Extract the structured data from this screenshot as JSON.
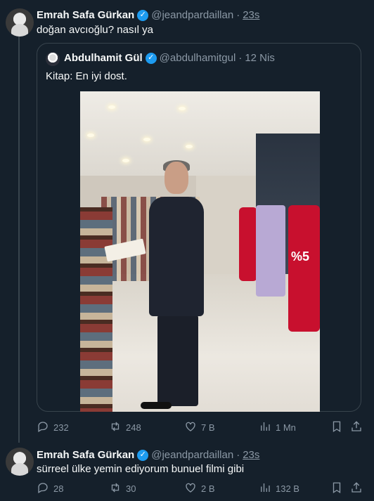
{
  "tweet1": {
    "author_name": "Emrah Safa Gürkan",
    "handle": "@jeandpardaillan",
    "separator": "·",
    "time": "23s",
    "text": "doğan avcıoğlu? nasıl ya",
    "quote": {
      "author_name": "Abdulhamit Gül",
      "handle": "@abdulhamitgul",
      "separator": "·",
      "date": "12 Nis",
      "text": "Kitap: En iyi dost."
    },
    "actions": {
      "replies": "232",
      "retweets": "248",
      "likes": "7 B",
      "views": "1 Mn"
    }
  },
  "tweet2": {
    "author_name": "Emrah Safa Gürkan",
    "handle": "@jeandpardaillan",
    "separator": "·",
    "time": "23s",
    "text": "sürreel ülke yemin ediyorum bunuel filmi gibi",
    "actions": {
      "replies": "28",
      "retweets": "30",
      "likes": "2 B",
      "views": "132 B"
    }
  },
  "colors": {
    "background": "#15202b",
    "text": "#f7f9f9",
    "muted": "#8b98a5",
    "border": "#38444d",
    "verified": "#1d9bf0"
  },
  "icons": [
    "reply-icon",
    "retweet-icon",
    "like-icon",
    "views-icon",
    "bookmark-icon",
    "share-icon",
    "verified-badge-icon"
  ]
}
